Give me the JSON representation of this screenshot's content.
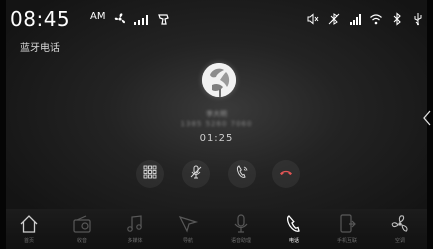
{
  "status_bar": {
    "time": "08:45",
    "ampm": "AM",
    "left_icons": [
      "fan-icon",
      "signal-bars-icon",
      "steering-wheel-icon"
    ],
    "right_icons": [
      "volume-mute-icon",
      "bluetooth-off-icon",
      "mobile-signal-icon",
      "wifi-icon",
      "bluetooth-icon",
      "usb-icon"
    ]
  },
  "page": {
    "title": "蓝牙电话"
  },
  "call": {
    "caller_name": "李大明",
    "caller_number": "1385 5260 7060",
    "duration": "01:25",
    "buttons": [
      "keypad-icon",
      "mute-icon",
      "handset-icon",
      "hang-up-icon"
    ]
  },
  "dock": {
    "items": [
      {
        "label": "首页",
        "icon": "home-icon",
        "active": false
      },
      {
        "label": "收音",
        "icon": "radio-icon",
        "active": false
      },
      {
        "label": "多媒体",
        "icon": "music-icon",
        "active": false
      },
      {
        "label": "导航",
        "icon": "navigation-icon",
        "active": false
      },
      {
        "label": "语音助理",
        "icon": "microphone-icon",
        "active": false
      },
      {
        "label": "电话",
        "icon": "phone-icon",
        "active": true
      },
      {
        "label": "手机互联",
        "icon": "phone-link-icon",
        "active": false
      },
      {
        "label": "空调",
        "icon": "fan-icon",
        "active": false
      }
    ]
  },
  "colors": {
    "background": "#1f1f1f",
    "dock": "#141414",
    "active_label": "#ffffff",
    "inactive_label": "#6e6e6e"
  }
}
